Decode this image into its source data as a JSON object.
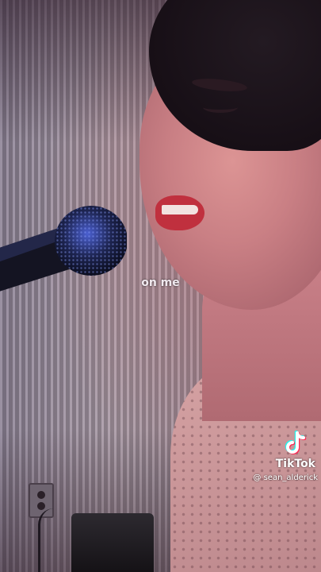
{
  "video": {
    "subtitle": "on me"
  },
  "watermark": {
    "brand": "TikTok",
    "username": "@ sean_alderick",
    "logo_icon": "tiktok-note-icon"
  },
  "colors": {
    "logo_cyan": "#25f4ee",
    "logo_red": "#fe2c55",
    "text": "#ffffff"
  }
}
